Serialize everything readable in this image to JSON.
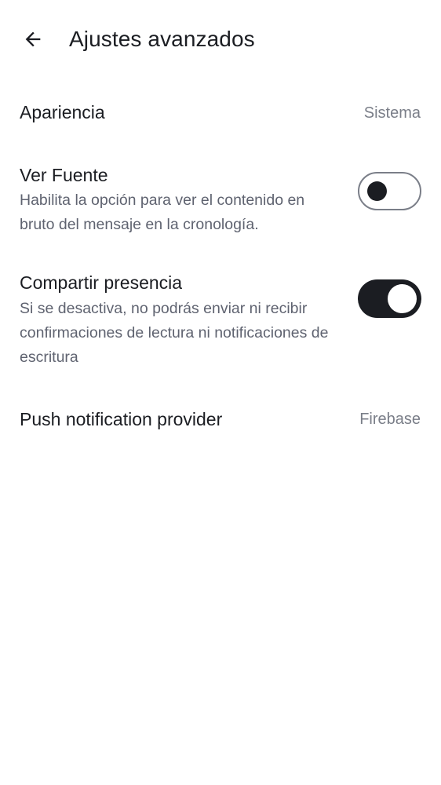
{
  "header": {
    "back_icon": "arrow-left-icon",
    "title": "Ajustes avanzados"
  },
  "settings": {
    "appearance": {
      "label": "Apariencia",
      "value": "Sistema"
    },
    "view_source": {
      "label": "Ver Fuente",
      "description": "Habilita la opción para ver el contenido en bruto del mensaje en la cronología.",
      "enabled": false
    },
    "share_presence": {
      "label": "Compartir presencia",
      "description": "Si se desactiva, no podrás enviar ni recibir confirmaciones de lectura ni notificaciones de escritura",
      "enabled": true
    },
    "push_provider": {
      "label": "Push notification provider",
      "value": "Firebase"
    }
  },
  "colors": {
    "primary_text": "#1b1d22",
    "secondary_text": "#5f6370",
    "value_text": "#7a7e88",
    "toggle_on": "#1b1d22",
    "background": "#ffffff"
  }
}
